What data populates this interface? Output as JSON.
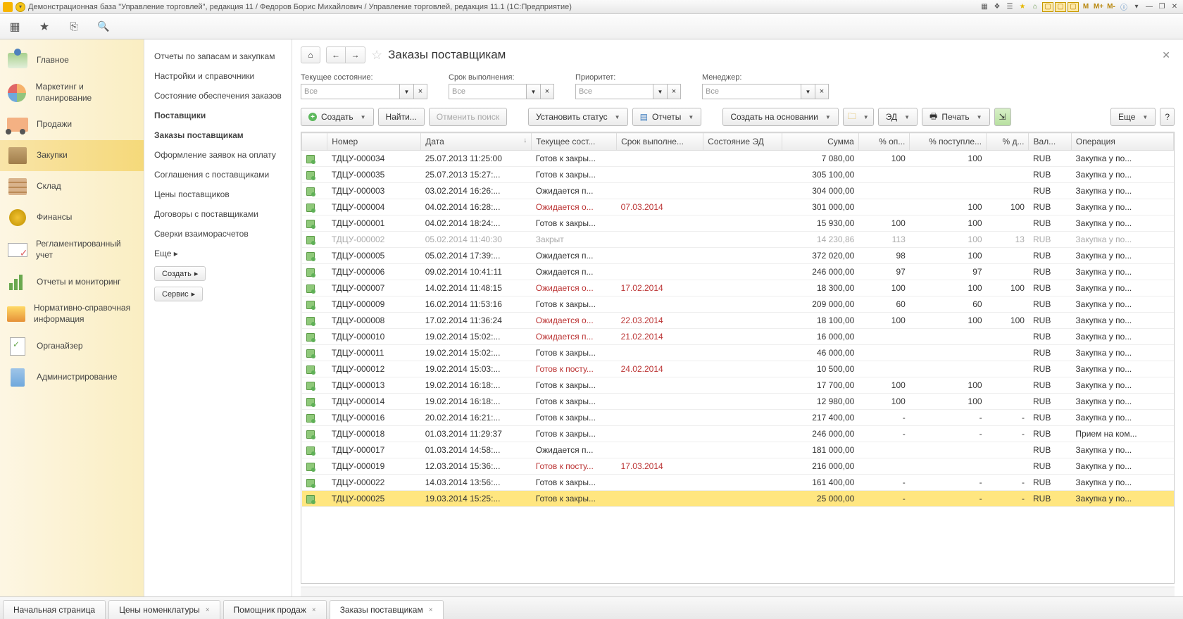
{
  "titlebar": {
    "text": "Демонстрационная база \"Управление торговлей\", редакция 11 / Федоров Борис Михайлович / Управление торговлей, редакция 11.1  (1С:Предприятие)",
    "m_buttons": [
      "M",
      "M+",
      "M-"
    ]
  },
  "nav": [
    {
      "label": "Главное"
    },
    {
      "label": "Маркетинг и планирование"
    },
    {
      "label": "Продажи"
    },
    {
      "label": "Закупки",
      "active": true
    },
    {
      "label": "Склад"
    },
    {
      "label": "Финансы"
    },
    {
      "label": "Регламентированный учет"
    },
    {
      "label": "Отчеты и мониторинг"
    },
    {
      "label": "Нормативно-справочная информация"
    },
    {
      "label": "Органайзер"
    },
    {
      "label": "Администрирование"
    }
  ],
  "subnav": {
    "items": [
      {
        "label": "Отчеты по запасам и закупкам"
      },
      {
        "label": "Настройки и справочники"
      },
      {
        "label": "Состояние обеспечения заказов"
      },
      {
        "label": "Поставщики",
        "bold": true
      },
      {
        "label": "Заказы поставщикам",
        "bold": true,
        "active": true
      },
      {
        "label": "Оформление заявок на оплату"
      },
      {
        "label": "Соглашения с поставщиками"
      },
      {
        "label": "Цены поставщиков"
      },
      {
        "label": "Договоры с поставщиками"
      },
      {
        "label": "Сверки взаиморасчетов"
      }
    ],
    "more": "Еще",
    "create": "Создать",
    "service": "Сервис"
  },
  "header": {
    "title": "Заказы поставщикам"
  },
  "filters": {
    "f1": {
      "label": "Текущее состояние:",
      "value": "Все"
    },
    "f2": {
      "label": "Срок выполнения:",
      "value": "Все"
    },
    "f3": {
      "label": "Приоритет:",
      "value": "Все"
    },
    "f4": {
      "label": "Менеджер:",
      "value": "Все"
    }
  },
  "toolbar": {
    "create": "Создать",
    "find": "Найти...",
    "cancel": "Отменить поиск",
    "status": "Установить статус",
    "reports": "Отчеты",
    "createon": "Создать на основании",
    "ed": "ЭД",
    "print": "Печать",
    "more": "Еще",
    "help": "?"
  },
  "columns": [
    "",
    "Номер",
    "Дата",
    "Текущее сост...",
    "Срок выполне...",
    "Состояние ЭД",
    "Сумма",
    "% оп...",
    "% поступле...",
    "% д...",
    "Вал...",
    "Операция"
  ],
  "rows": [
    {
      "n": "ТДЦУ-000034",
      "d": "25.07.2013 11:25:00",
      "s": "Готов к закры...",
      "due": "",
      "sum": "7 080,00",
      "op": "100",
      "post": "100",
      "dost": "",
      "cur": "RUB",
      "oper": "Закупка у по..."
    },
    {
      "n": "ТДЦУ-000035",
      "d": "25.07.2013 15:27:...",
      "s": "Готов к закры...",
      "due": "",
      "sum": "305 100,00",
      "op": "",
      "post": "",
      "dost": "",
      "cur": "RUB",
      "oper": "Закупка у по..."
    },
    {
      "n": "ТДЦУ-000003",
      "d": "03.02.2014 16:26:...",
      "s": "Ожидается п...",
      "due": "",
      "sum": "304 000,00",
      "op": "",
      "post": "",
      "dost": "",
      "cur": "RUB",
      "oper": "Закупка у по..."
    },
    {
      "n": "ТДЦУ-000004",
      "d": "04.02.2014 16:28:...",
      "s": "Ожидается о...",
      "s_red": true,
      "due": "07.03.2014",
      "due_red": true,
      "sum": "301 000,00",
      "op": "",
      "post": "100",
      "dost": "100",
      "cur": "RUB",
      "oper": "Закупка у по..."
    },
    {
      "n": "ТДЦУ-000001",
      "d": "04.02.2014 18:24:...",
      "s": "Готов к закры...",
      "due": "",
      "sum": "15 930,00",
      "op": "100",
      "post": "100",
      "dost": "",
      "cur": "RUB",
      "oper": "Закупка у по..."
    },
    {
      "n": "ТДЦУ-000002",
      "d": "05.02.2014 11:40:30",
      "s": "Закрыт",
      "due": "",
      "sum": "14 230,86",
      "op": "113",
      "post": "100",
      "dost": "13",
      "cur": "RUB",
      "oper": "Закупка у по...",
      "muted": true
    },
    {
      "n": "ТДЦУ-000005",
      "d": "05.02.2014 17:39:...",
      "s": "Ожидается п...",
      "due": "",
      "sum": "372 020,00",
      "op": "98",
      "post": "100",
      "dost": "",
      "cur": "RUB",
      "oper": "Закупка у по..."
    },
    {
      "n": "ТДЦУ-000006",
      "d": "09.02.2014 10:41:11",
      "s": "Ожидается п...",
      "due": "",
      "sum": "246 000,00",
      "op": "97",
      "post": "97",
      "dost": "",
      "cur": "RUB",
      "oper": "Закупка у по..."
    },
    {
      "n": "ТДЦУ-000007",
      "d": "14.02.2014 11:48:15",
      "s": "Ожидается о...",
      "s_red": true,
      "due": "17.02.2014",
      "due_red": true,
      "sum": "18 300,00",
      "op": "100",
      "post": "100",
      "dost": "100",
      "cur": "RUB",
      "oper": "Закупка у по..."
    },
    {
      "n": "ТДЦУ-000009",
      "d": "16.02.2014 11:53:16",
      "s": "Готов к закры...",
      "due": "",
      "sum": "209 000,00",
      "op": "60",
      "post": "60",
      "dost": "",
      "cur": "RUB",
      "oper": "Закупка у по..."
    },
    {
      "n": "ТДЦУ-000008",
      "d": "17.02.2014 11:36:24",
      "s": "Ожидается о...",
      "s_red": true,
      "due": "22.03.2014",
      "due_red": true,
      "sum": "18 100,00",
      "op": "100",
      "post": "100",
      "dost": "100",
      "cur": "RUB",
      "oper": "Закупка у по..."
    },
    {
      "n": "ТДЦУ-000010",
      "d": "19.02.2014 15:02:...",
      "s": "Ожидается п...",
      "s_red": true,
      "due": "21.02.2014",
      "due_red": true,
      "sum": "16 000,00",
      "op": "",
      "post": "",
      "dost": "",
      "cur": "RUB",
      "oper": "Закупка у по..."
    },
    {
      "n": "ТДЦУ-000011",
      "d": "19.02.2014 15:02:...",
      "s": "Готов к закры...",
      "due": "",
      "sum": "46 000,00",
      "op": "",
      "post": "",
      "dost": "",
      "cur": "RUB",
      "oper": "Закупка у по..."
    },
    {
      "n": "ТДЦУ-000012",
      "d": "19.02.2014 15:03:...",
      "s": "Готов к посту...",
      "s_red": true,
      "due": "24.02.2014",
      "due_red": true,
      "sum": "10 500,00",
      "op": "",
      "post": "",
      "dost": "",
      "cur": "RUB",
      "oper": "Закупка у по..."
    },
    {
      "n": "ТДЦУ-000013",
      "d": "19.02.2014 16:18:...",
      "s": "Готов к закры...",
      "due": "",
      "sum": "17 700,00",
      "op": "100",
      "post": "100",
      "dost": "",
      "cur": "RUB",
      "oper": "Закупка у по..."
    },
    {
      "n": "ТДЦУ-000014",
      "d": "19.02.2014 16:18:...",
      "s": "Готов к закры...",
      "due": "",
      "sum": "12 980,00",
      "op": "100",
      "post": "100",
      "dost": "",
      "cur": "RUB",
      "oper": "Закупка у по..."
    },
    {
      "n": "ТДЦУ-000016",
      "d": "20.02.2014 16:21:...",
      "s": "Готов к закры...",
      "due": "",
      "sum": "217 400,00",
      "op": "-",
      "post": "-",
      "dost": "-",
      "cur": "RUB",
      "oper": "Закупка у по..."
    },
    {
      "n": "ТДЦУ-000018",
      "d": "01.03.2014 11:29:37",
      "s": "Готов к закры...",
      "due": "",
      "sum": "246 000,00",
      "op": "-",
      "post": "-",
      "dost": "-",
      "cur": "RUB",
      "oper": "Прием на ком..."
    },
    {
      "n": "ТДЦУ-000017",
      "d": "01.03.2014 14:58:...",
      "s": "Ожидается п...",
      "due": "",
      "sum": "181 000,00",
      "op": "",
      "post": "",
      "dost": "",
      "cur": "RUB",
      "oper": "Закупка у по..."
    },
    {
      "n": "ТДЦУ-000019",
      "d": "12.03.2014 15:36:...",
      "s": "Готов к посту...",
      "s_red": true,
      "due": "17.03.2014",
      "due_red": true,
      "sum": "216 000,00",
      "op": "",
      "post": "",
      "dost": "",
      "cur": "RUB",
      "oper": "Закупка у по..."
    },
    {
      "n": "ТДЦУ-000022",
      "d": "14.03.2014 13:56:...",
      "s": "Готов к закры...",
      "due": "",
      "sum": "161 400,00",
      "op": "-",
      "post": "-",
      "dost": "-",
      "cur": "RUB",
      "oper": "Закупка у по..."
    },
    {
      "n": "ТДЦУ-000025",
      "d": "19.03.2014 15:25:...",
      "s": "Готов к закры...",
      "due": "",
      "sum": "25 000,00",
      "op": "-",
      "post": "-",
      "dost": "-",
      "cur": "RUB",
      "oper": "Закупка у по...",
      "selected": true
    }
  ],
  "tabs": [
    {
      "label": "Начальная страница",
      "closable": false
    },
    {
      "label": "Цены номенклатуры",
      "closable": true
    },
    {
      "label": "Помощник продаж",
      "closable": true
    },
    {
      "label": "Заказы поставщикам",
      "closable": true,
      "active": true
    }
  ]
}
